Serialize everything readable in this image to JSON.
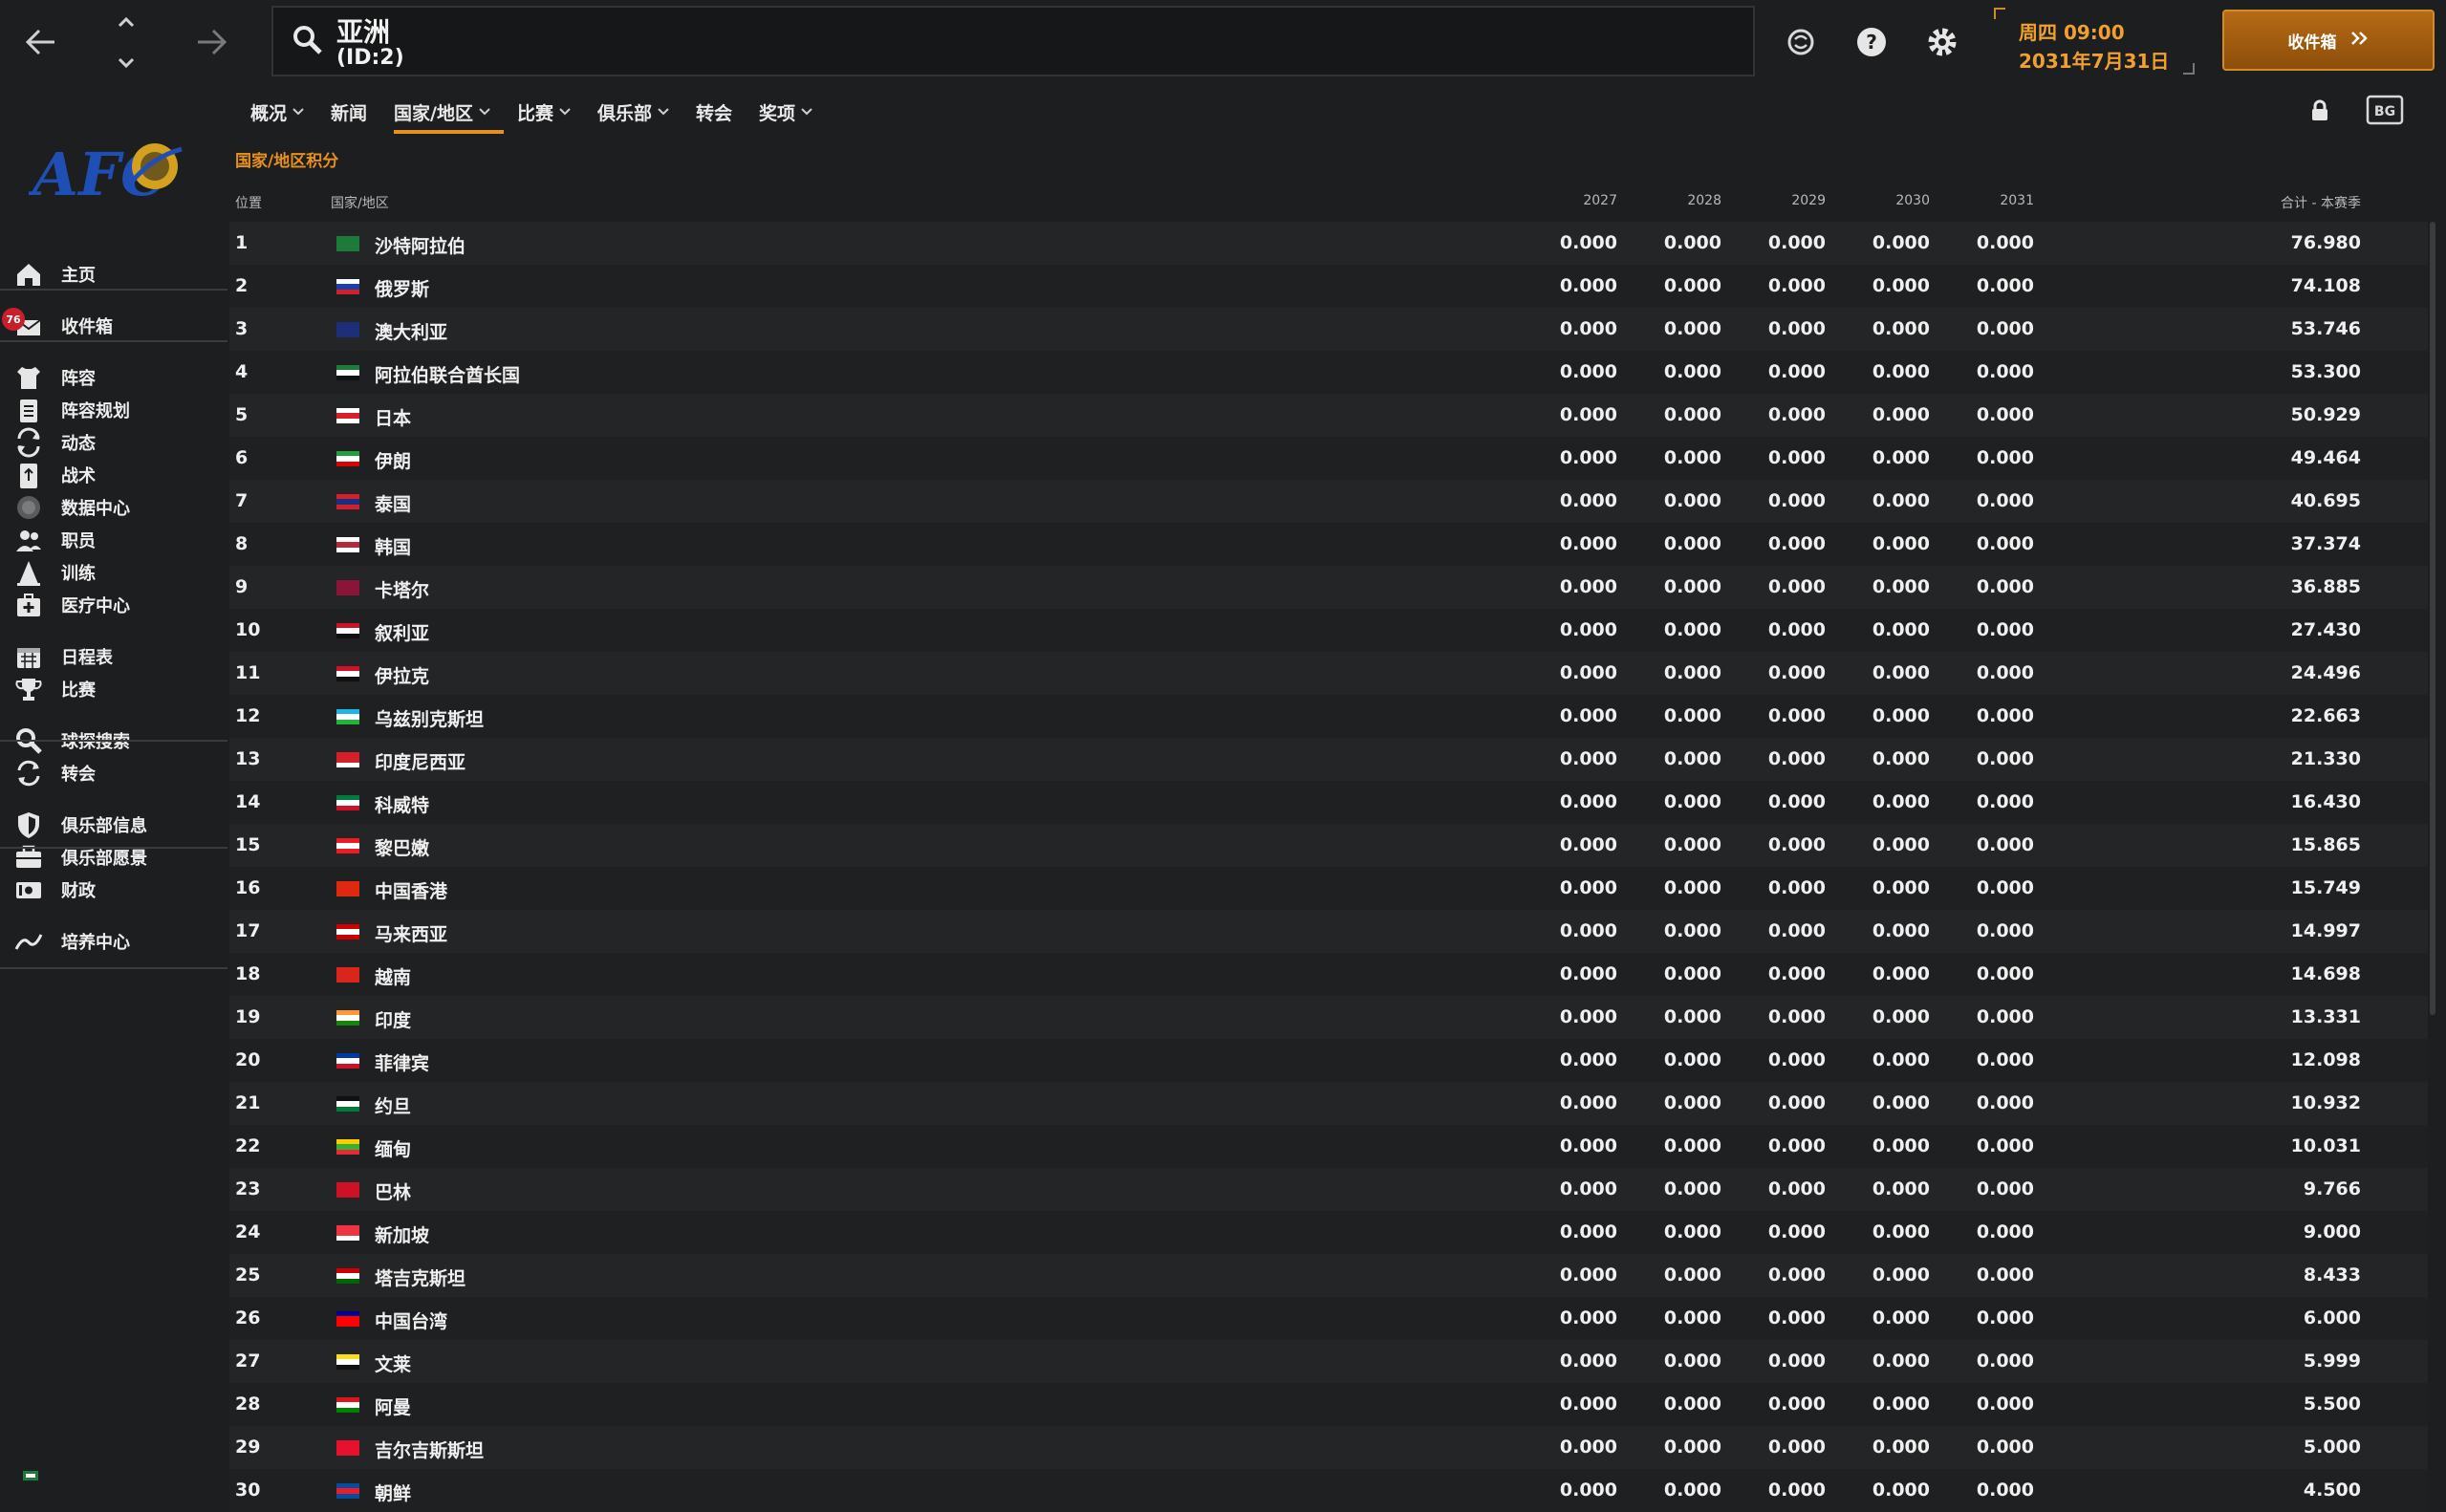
{
  "search": {
    "title": "亚洲",
    "subtitle": "(ID:2)"
  },
  "datetime": {
    "day_time": "周四 09:00",
    "date": "2031年7月31日"
  },
  "inbox_button": {
    "label": "收件箱"
  },
  "menu": [
    {
      "label": "概况",
      "dropdown": true,
      "active": false
    },
    {
      "label": "新闻",
      "dropdown": false,
      "active": false
    },
    {
      "label": "国家/地区",
      "dropdown": true,
      "active": true
    },
    {
      "label": "比赛",
      "dropdown": true,
      "active": false
    },
    {
      "label": "俱乐部",
      "dropdown": true,
      "active": false
    },
    {
      "label": "转会",
      "dropdown": false,
      "active": false
    },
    {
      "label": "奖项",
      "dropdown": true,
      "active": false
    }
  ],
  "sidebar": {
    "items": [
      {
        "label": "主页",
        "icon": "home-icon"
      },
      {
        "label": "收件箱",
        "icon": "inbox-icon",
        "badge": "76"
      },
      {
        "label": "阵容",
        "icon": "shirt-icon"
      },
      {
        "label": "阵容规划",
        "icon": "clipboard-icon"
      },
      {
        "label": "动态",
        "icon": "dynamics-icon"
      },
      {
        "label": "战术",
        "icon": "tactics-icon"
      },
      {
        "label": "数据中心",
        "icon": "data-hub-icon"
      },
      {
        "label": "职员",
        "icon": "staff-icon"
      },
      {
        "label": "训练",
        "icon": "training-icon"
      },
      {
        "label": "医疗中心",
        "icon": "medical-icon"
      },
      {
        "label": "日程表",
        "icon": "calendar-icon"
      },
      {
        "label": "比赛",
        "icon": "trophy-icon"
      },
      {
        "label": "球探搜索",
        "icon": "scout-search-icon"
      },
      {
        "label": "转会",
        "icon": "transfer-icon"
      },
      {
        "label": "俱乐部信息",
        "icon": "shield-icon"
      },
      {
        "label": "俱乐部愿景",
        "icon": "briefcase-icon"
      },
      {
        "label": "财政",
        "icon": "finance-icon"
      },
      {
        "label": "培养中心",
        "icon": "development-icon"
      }
    ]
  },
  "table": {
    "title": "国家/地区积分",
    "headers": {
      "pos": "位置",
      "country": "国家/地区",
      "y2027": "2027",
      "y2028": "2028",
      "y2029": "2029",
      "y2030": "2030",
      "y2031": "2031",
      "total": "合计 - 本赛季"
    },
    "rows": [
      {
        "pos": "1",
        "country": "沙特阿拉伯",
        "vals": [
          "0.000",
          "0.000",
          "0.000",
          "0.000",
          "0.000"
        ],
        "total": "76.980",
        "flag": [
          "#1c7a3a",
          "#1c7a3a",
          "#1c7a3a"
        ]
      },
      {
        "pos": "2",
        "country": "俄罗斯",
        "vals": [
          "0.000",
          "0.000",
          "0.000",
          "0.000",
          "0.000"
        ],
        "total": "74.108",
        "flag": [
          "#ffffff",
          "#1c3fb0",
          "#d5202a"
        ]
      },
      {
        "pos": "3",
        "country": "澳大利亚",
        "vals": [
          "0.000",
          "0.000",
          "0.000",
          "0.000",
          "0.000"
        ],
        "total": "53.746",
        "flag": [
          "#1e2f7a",
          "#1e2f7a",
          "#1e2f7a"
        ]
      },
      {
        "pos": "4",
        "country": "阿拉伯联合酋长国",
        "vals": [
          "0.000",
          "0.000",
          "0.000",
          "0.000",
          "0.000"
        ],
        "total": "53.300",
        "flag": [
          "#1c7a3a",
          "#ffffff",
          "#111111"
        ]
      },
      {
        "pos": "5",
        "country": "日本",
        "vals": [
          "0.000",
          "0.000",
          "0.000",
          "0.000",
          "0.000"
        ],
        "total": "50.929",
        "flag": [
          "#ffffff",
          "#d5202a",
          "#ffffff"
        ]
      },
      {
        "pos": "6",
        "country": "伊朗",
        "vals": [
          "0.000",
          "0.000",
          "0.000",
          "0.000",
          "0.000"
        ],
        "total": "49.464",
        "flag": [
          "#239f40",
          "#ffffff",
          "#da0000"
        ]
      },
      {
        "pos": "7",
        "country": "泰国",
        "vals": [
          "0.000",
          "0.000",
          "0.000",
          "0.000",
          "0.000"
        ],
        "total": "40.695",
        "flag": [
          "#d5202a",
          "#1c2e80",
          "#d5202a"
        ]
      },
      {
        "pos": "8",
        "country": "韩国",
        "vals": [
          "0.000",
          "0.000",
          "0.000",
          "0.000",
          "0.000"
        ],
        "total": "37.374",
        "flag": [
          "#ffffff",
          "#b7273a",
          "#ffffff"
        ]
      },
      {
        "pos": "9",
        "country": "卡塔尔",
        "vals": [
          "0.000",
          "0.000",
          "0.000",
          "0.000",
          "0.000"
        ],
        "total": "36.885",
        "flag": [
          "#8a1538",
          "#8a1538",
          "#8a1538"
        ]
      },
      {
        "pos": "10",
        "country": "叙利亚",
        "vals": [
          "0.000",
          "0.000",
          "0.000",
          "0.000",
          "0.000"
        ],
        "total": "27.430",
        "flag": [
          "#ce1126",
          "#ffffff",
          "#111111"
        ]
      },
      {
        "pos": "11",
        "country": "伊拉克",
        "vals": [
          "0.000",
          "0.000",
          "0.000",
          "0.000",
          "0.000"
        ],
        "total": "24.496",
        "flag": [
          "#ce1126",
          "#ffffff",
          "#111111"
        ]
      },
      {
        "pos": "12",
        "country": "乌兹别克斯坦",
        "vals": [
          "0.000",
          "0.000",
          "0.000",
          "0.000",
          "0.000"
        ],
        "total": "22.663",
        "flag": [
          "#1eb5e5",
          "#ffffff",
          "#1eb53a"
        ]
      },
      {
        "pos": "13",
        "country": "印度尼西亚",
        "vals": [
          "0.000",
          "0.000",
          "0.000",
          "0.000",
          "0.000"
        ],
        "total": "21.330",
        "flag": [
          "#d5202a",
          "#d5202a",
          "#ffffff"
        ]
      },
      {
        "pos": "14",
        "country": "科威特",
        "vals": [
          "0.000",
          "0.000",
          "0.000",
          "0.000",
          "0.000"
        ],
        "total": "16.430",
        "flag": [
          "#007a3d",
          "#ffffff",
          "#ce1126"
        ]
      },
      {
        "pos": "15",
        "country": "黎巴嫩",
        "vals": [
          "0.000",
          "0.000",
          "0.000",
          "0.000",
          "0.000"
        ],
        "total": "15.865",
        "flag": [
          "#ed1c24",
          "#ffffff",
          "#ed1c24"
        ]
      },
      {
        "pos": "16",
        "country": "中国香港",
        "vals": [
          "0.000",
          "0.000",
          "0.000",
          "0.000",
          "0.000"
        ],
        "total": "15.749",
        "flag": [
          "#de2910",
          "#de2910",
          "#de2910"
        ]
      },
      {
        "pos": "17",
        "country": "马来西亚",
        "vals": [
          "0.000",
          "0.000",
          "0.000",
          "0.000",
          "0.000"
        ],
        "total": "14.997",
        "flag": [
          "#cc0001",
          "#ffffff",
          "#cc0001"
        ]
      },
      {
        "pos": "18",
        "country": "越南",
        "vals": [
          "0.000",
          "0.000",
          "0.000",
          "0.000",
          "0.000"
        ],
        "total": "14.698",
        "flag": [
          "#da251d",
          "#da251d",
          "#da251d"
        ]
      },
      {
        "pos": "19",
        "country": "印度",
        "vals": [
          "0.000",
          "0.000",
          "0.000",
          "0.000",
          "0.000"
        ],
        "total": "13.331",
        "flag": [
          "#ff9933",
          "#ffffff",
          "#138808"
        ]
      },
      {
        "pos": "20",
        "country": "菲律宾",
        "vals": [
          "0.000",
          "0.000",
          "0.000",
          "0.000",
          "0.000"
        ],
        "total": "12.098",
        "flag": [
          "#0038a8",
          "#ffffff",
          "#ce1126"
        ]
      },
      {
        "pos": "21",
        "country": "约旦",
        "vals": [
          "0.000",
          "0.000",
          "0.000",
          "0.000",
          "0.000"
        ],
        "total": "10.932",
        "flag": [
          "#111111",
          "#ffffff",
          "#007a3d"
        ]
      },
      {
        "pos": "22",
        "country": "缅甸",
        "vals": [
          "0.000",
          "0.000",
          "0.000",
          "0.000",
          "0.000"
        ],
        "total": "10.031",
        "flag": [
          "#fecb00",
          "#34b233",
          "#ea2839"
        ]
      },
      {
        "pos": "23",
        "country": "巴林",
        "vals": [
          "0.000",
          "0.000",
          "0.000",
          "0.000",
          "0.000"
        ],
        "total": "9.766",
        "flag": [
          "#ce1126",
          "#ce1126",
          "#ce1126"
        ]
      },
      {
        "pos": "24",
        "country": "新加坡",
        "vals": [
          "0.000",
          "0.000",
          "0.000",
          "0.000",
          "0.000"
        ],
        "total": "9.000",
        "flag": [
          "#ef3340",
          "#ef3340",
          "#ffffff"
        ]
      },
      {
        "pos": "25",
        "country": "塔吉克斯坦",
        "vals": [
          "0.000",
          "0.000",
          "0.000",
          "0.000",
          "0.000"
        ],
        "total": "8.433",
        "flag": [
          "#cc0000",
          "#ffffff",
          "#006600"
        ]
      },
      {
        "pos": "26",
        "country": "中国台湾",
        "vals": [
          "0.000",
          "0.000",
          "0.000",
          "0.000",
          "0.000"
        ],
        "total": "6.000",
        "flag": [
          "#000095",
          "#fe0000",
          "#fe0000"
        ]
      },
      {
        "pos": "27",
        "country": "文莱",
        "vals": [
          "0.000",
          "0.000",
          "0.000",
          "0.000",
          "0.000"
        ],
        "total": "5.999",
        "flag": [
          "#f7e017",
          "#ffffff",
          "#111111"
        ]
      },
      {
        "pos": "28",
        "country": "阿曼",
        "vals": [
          "0.000",
          "0.000",
          "0.000",
          "0.000",
          "0.000"
        ],
        "total": "5.500",
        "flag": [
          "#db161b",
          "#ffffff",
          "#008000"
        ]
      },
      {
        "pos": "29",
        "country": "吉尔吉斯斯坦",
        "vals": [
          "0.000",
          "0.000",
          "0.000",
          "0.000",
          "0.000"
        ],
        "total": "5.000",
        "flag": [
          "#e8112d",
          "#e8112d",
          "#e8112d"
        ]
      },
      {
        "pos": "30",
        "country": "朝鲜",
        "vals": [
          "0.000",
          "0.000",
          "0.000",
          "0.000",
          "0.000"
        ],
        "total": "4.500",
        "flag": [
          "#024fa2",
          "#ed1c27",
          "#024fa2"
        ]
      }
    ]
  },
  "colors": {
    "accent": "#e8901e",
    "bg": "#1d1e20"
  }
}
